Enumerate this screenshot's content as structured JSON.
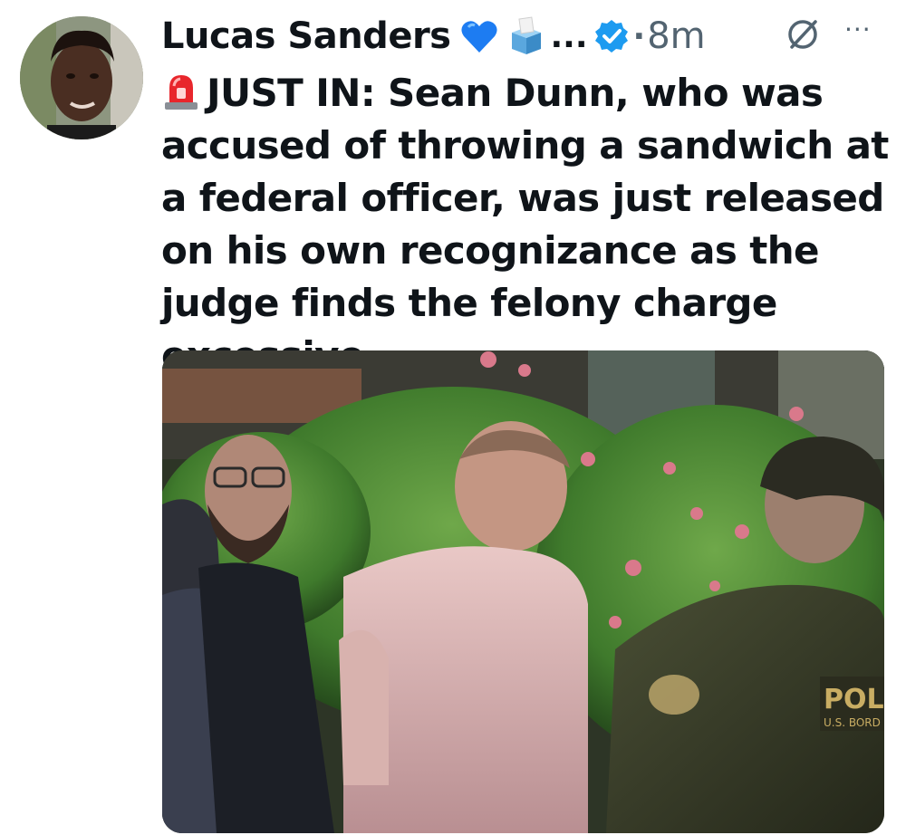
{
  "tweet": {
    "author": {
      "display_name": "Lucas Sanders",
      "name_truncation": "...",
      "verified": true,
      "avatar_icon": "user-avatar-photo"
    },
    "meta": {
      "separator": "·",
      "time_ago": "8m"
    },
    "icons": {
      "heart": "blue-heart-icon",
      "ballot": "ballot-box-icon",
      "verified": "verified-badge-icon",
      "grok": "grok-icon",
      "more": "more-options-icon",
      "siren": "rotating-light-icon"
    },
    "more_label": "···",
    "text": "JUST IN: Sean Dunn, who was accused of throwing a sandwich at a federal officer, was just released on his own recognizance as the judge finds the felony charge excessive.",
    "media": {
      "type": "photo",
      "patch_text": "POL",
      "patch_subtext": "U.S. BORD"
    }
  },
  "colors": {
    "verified_blue": "#1d9bf0",
    "heart_blue": "#1d7cf2",
    "text_primary": "#0f1419",
    "text_secondary": "#536471"
  }
}
